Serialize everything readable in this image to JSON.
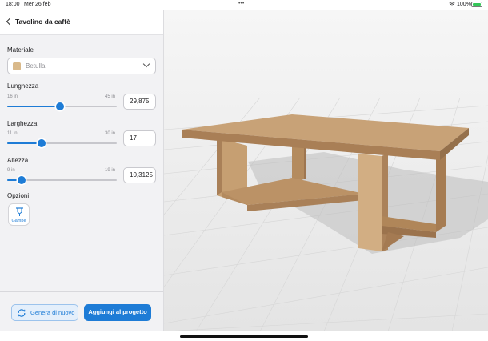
{
  "status_bar": {
    "time": "18:00",
    "date": "Mer 26 feb",
    "battery_percent": "100%",
    "battery_level": 1.0
  },
  "header": {
    "title": "Tavolino da caffè"
  },
  "material": {
    "label": "Materiale",
    "value": "Betulla",
    "swatch_color": "#d9b98a"
  },
  "dimensions": [
    {
      "label": "Lunghezza",
      "min_label": "16 in",
      "max_label": "45 in",
      "value": "29,875",
      "min": 16,
      "max": 45,
      "current": 29.875
    },
    {
      "label": "Larghezza",
      "min_label": "11 in",
      "max_label": "30 in",
      "value": "17",
      "min": 11,
      "max": 30,
      "current": 17
    },
    {
      "label": "Altezza",
      "min_label": "9 in",
      "max_label": "19 in",
      "value": "10,3125",
      "min": 9,
      "max": 19,
      "current": 10.3125
    }
  ],
  "options": {
    "label": "Opzioni",
    "items": [
      {
        "label": "Gambe",
        "icon": "table-legs-icon"
      }
    ]
  },
  "footer": {
    "regenerate_label": "Genera di nuovo",
    "add_label": "Aggiungi al progetto"
  },
  "colors": {
    "accent": "#1e7cd6",
    "wood_top": "#c49a6c",
    "wood_side": "#b78a5c"
  }
}
